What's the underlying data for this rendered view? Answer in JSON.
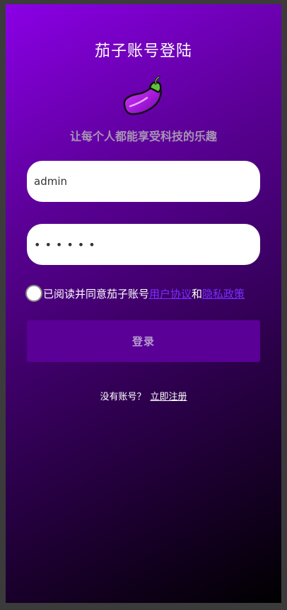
{
  "header": {
    "title": "茄子账号登陆",
    "slogan": "让每个人都能享受科技的乐趣",
    "logo_icon": "eggplant-icon"
  },
  "form": {
    "username_value": "admin",
    "password_value": "••••••"
  },
  "agreement": {
    "text": "已阅读并同意茄子账号",
    "user_agreement": "用户协议",
    "and": "和",
    "privacy_policy": "隐私政策"
  },
  "login": {
    "label": "登录"
  },
  "register": {
    "prompt": "没有账号？",
    "link": "立即注册"
  },
  "colors": {
    "gradient_start": "#8b00e6",
    "gradient_end": "#000000",
    "button": "#5a0096",
    "link": "#7a2dff"
  }
}
